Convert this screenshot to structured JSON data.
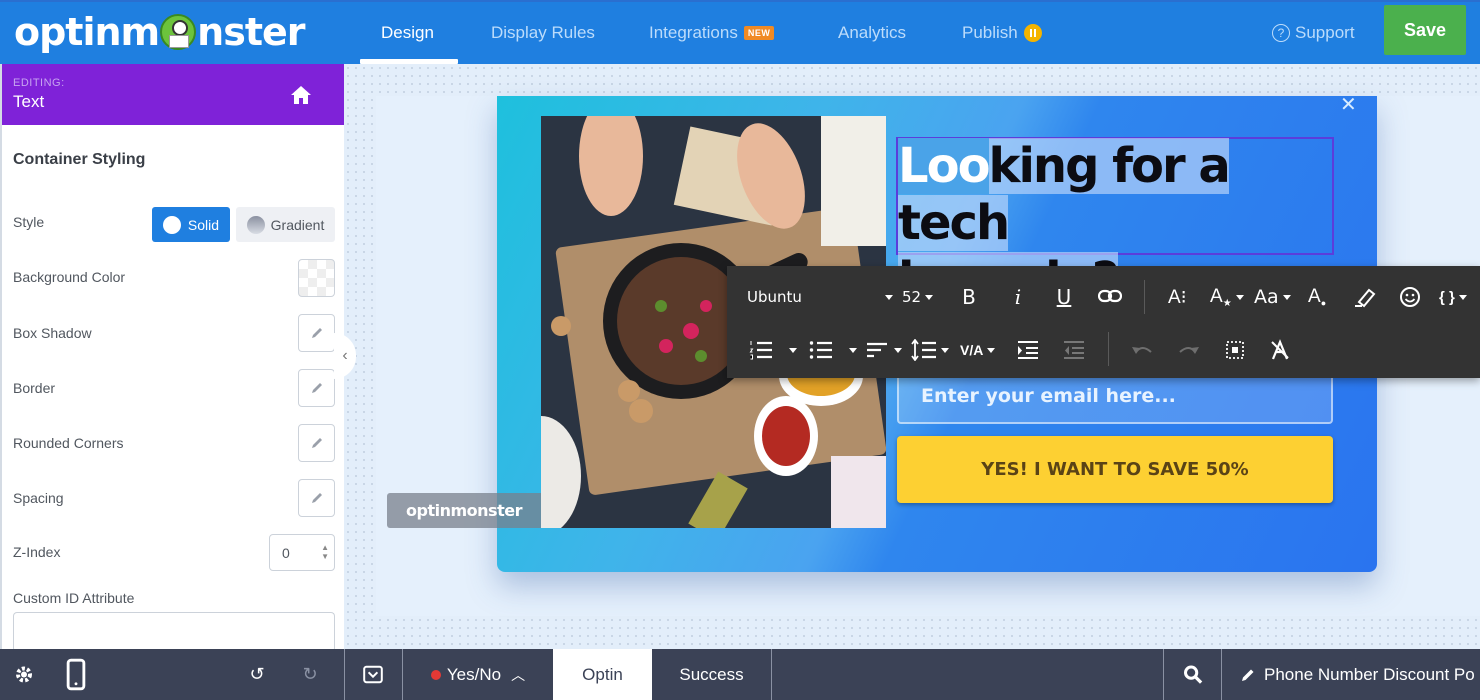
{
  "app": {
    "brand": "optinmonster",
    "brand_parts": [
      "optinm",
      "nster"
    ]
  },
  "topnav": {
    "tabs": [
      {
        "label": "Design",
        "active": true
      },
      {
        "label": "Display Rules",
        "active": false
      },
      {
        "label": "Integrations",
        "active": false,
        "badge": "NEW"
      },
      {
        "label": "Analytics",
        "active": false
      },
      {
        "label": "Publish",
        "active": false,
        "status_icon": "pause-circle-icon"
      }
    ],
    "support_label": "Support",
    "save_label": "Save",
    "colors": {
      "bar": "#1f7fe0",
      "save": "#4bb04d",
      "new_badge": "#f08a24",
      "publish_status": "#f4b400"
    }
  },
  "sidebar": {
    "editing_label": "EDITING:",
    "editing_title": "Text",
    "section_title": "Container Styling",
    "style": {
      "label": "Style",
      "options": [
        "Solid",
        "Gradient"
      ],
      "selected": "Solid"
    },
    "rows": [
      {
        "label": "Background Color",
        "control": "color-swatch"
      },
      {
        "label": "Box Shadow",
        "control": "edit"
      },
      {
        "label": "Border",
        "control": "edit"
      },
      {
        "label": "Rounded Corners",
        "control": "edit"
      },
      {
        "label": "Spacing",
        "control": "edit"
      }
    ],
    "zindex": {
      "label": "Z-Index",
      "value": "0"
    },
    "custom_id": {
      "label": "Custom ID Attribute",
      "value": ""
    },
    "colors": {
      "header": "#7f22d8",
      "accent": "#1f7fe0"
    }
  },
  "canvas": {
    "popup": {
      "headline_selected": "Loo",
      "headline_rest_line1": "king for a tech",
      "headline_line2": "bargain?",
      "email_placeholder": "Enter your email here...",
      "cta_label": "YES! I WANT TO SAVE 50%",
      "badge": "optinmonster",
      "colors": {
        "cta": "#fdd032",
        "cta_text": "#5a4316",
        "gradient_start": "#1ec0dd",
        "gradient_end": "#2a74ef"
      }
    }
  },
  "toolbar": {
    "font_family": "Ubuntu",
    "font_size": "52",
    "row1": [
      "bold-icon",
      "italic-icon",
      "underline-icon",
      "link-icon",
      "line-height-icon",
      "font-effect-icon",
      "text-case-icon",
      "text-color-icon",
      "highlight-icon",
      "emoji-icon",
      "smart-tags-icon"
    ],
    "row2": [
      "ordered-list-icon",
      "unordered-list-icon",
      "align-icon",
      "line-spacing-icon",
      "letter-spacing-icon",
      "indent-icon",
      "outdent-icon",
      "undo-icon",
      "redo-icon",
      "select-all-icon",
      "clear-format-icon"
    ],
    "labels": {
      "bold": "B",
      "italic": "i",
      "underline": "U",
      "case": "Aa",
      "letter_spacing": "V/A",
      "smart_tags": "{ }"
    }
  },
  "bottombar": {
    "view_toggle": "Yes/No",
    "tabs": [
      {
        "label": "Optin",
        "active": true
      },
      {
        "label": "Success",
        "active": false
      }
    ],
    "campaign_name": "Phone Number Discount Po"
  }
}
